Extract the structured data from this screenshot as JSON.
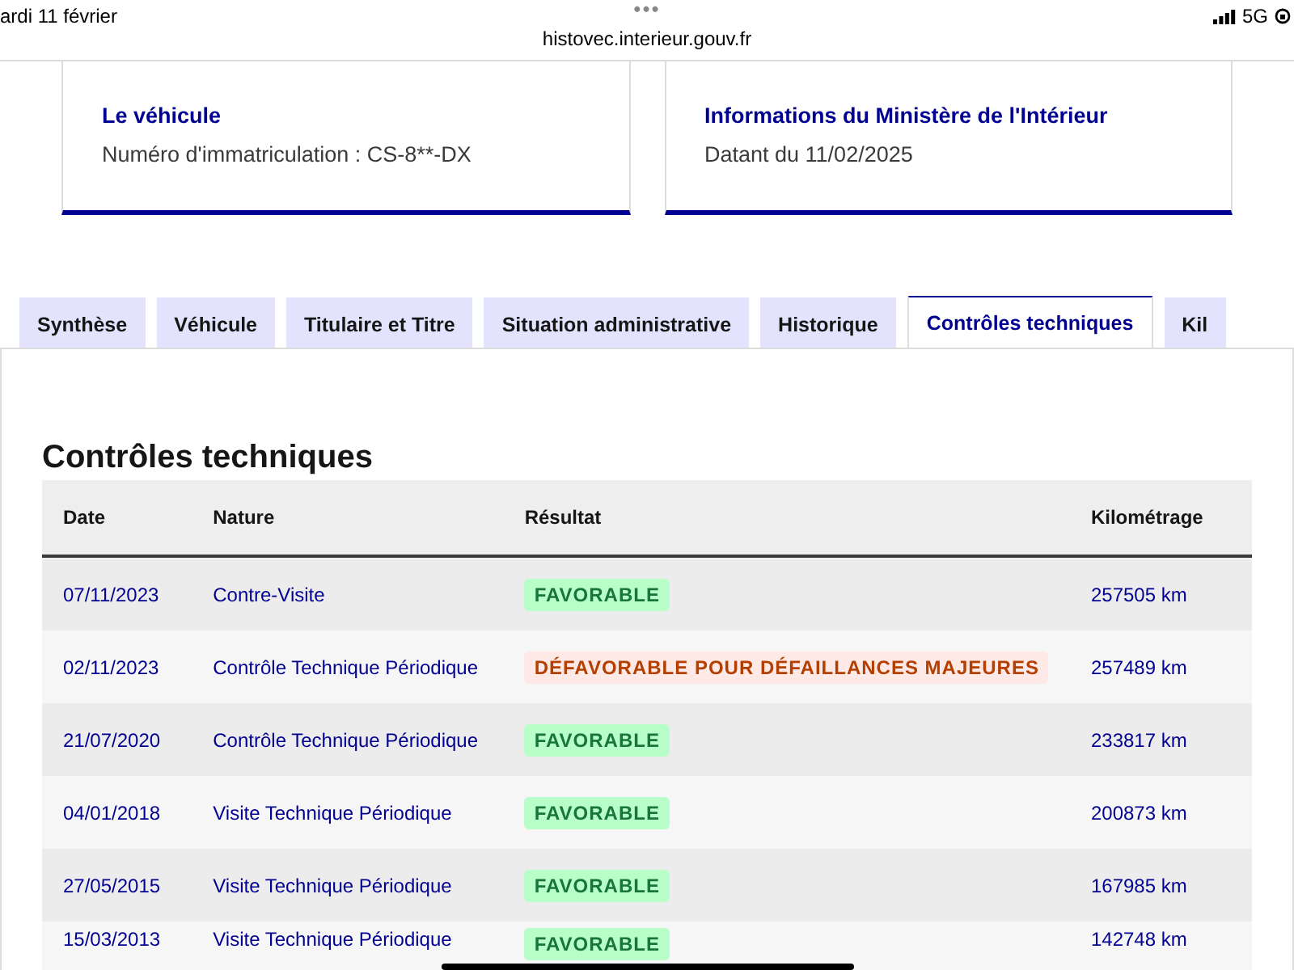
{
  "status_bar": {
    "date": "ardi 11 février",
    "dots": "•••",
    "url": "histovec.interieur.gouv.fr",
    "network": "5G"
  },
  "cards": [
    {
      "title": "Le véhicule",
      "text": "Numéro d'immatriculation : CS-8**-DX"
    },
    {
      "title": "Informations du Ministère de l'Intérieur",
      "text": "Datant du 11/02/2025"
    }
  ],
  "tabs": [
    {
      "label": "Synthèse",
      "selected": false
    },
    {
      "label": "Véhicule",
      "selected": false
    },
    {
      "label": "Titulaire et Titre",
      "selected": false
    },
    {
      "label": "Situation administrative",
      "selected": false
    },
    {
      "label": "Historique",
      "selected": false
    },
    {
      "label": "Contrôles techniques",
      "selected": true
    },
    {
      "label": "Kil",
      "selected": false
    }
  ],
  "heading": "Contrôles techniques",
  "table": {
    "columns": [
      "Date",
      "Nature",
      "Résultat",
      "Kilométrage"
    ],
    "rows": [
      {
        "date": "07/11/2023",
        "nature": "Contre-Visite",
        "result": "FAVORABLE",
        "kind": "favorable",
        "km": "257505 km"
      },
      {
        "date": "02/11/2023",
        "nature": "Contrôle Technique Périodique",
        "result": "DÉFAVORABLE POUR DÉFAILLANCES MAJEURES",
        "kind": "unfavorable",
        "km": "257489 km"
      },
      {
        "date": "21/07/2020",
        "nature": "Contrôle Technique Périodique",
        "result": "FAVORABLE",
        "kind": "favorable",
        "km": "233817 km"
      },
      {
        "date": "04/01/2018",
        "nature": "Visite Technique Périodique",
        "result": "FAVORABLE",
        "kind": "favorable",
        "km": "200873 km"
      },
      {
        "date": "27/05/2015",
        "nature": "Visite Technique Périodique",
        "result": "FAVORABLE",
        "kind": "favorable",
        "km": "167985 km"
      },
      {
        "date": "15/03/2013",
        "nature": "Visite Technique Périodique",
        "result": "FAVORABLE",
        "kind": "favorable",
        "km": "142748 km"
      }
    ]
  }
}
